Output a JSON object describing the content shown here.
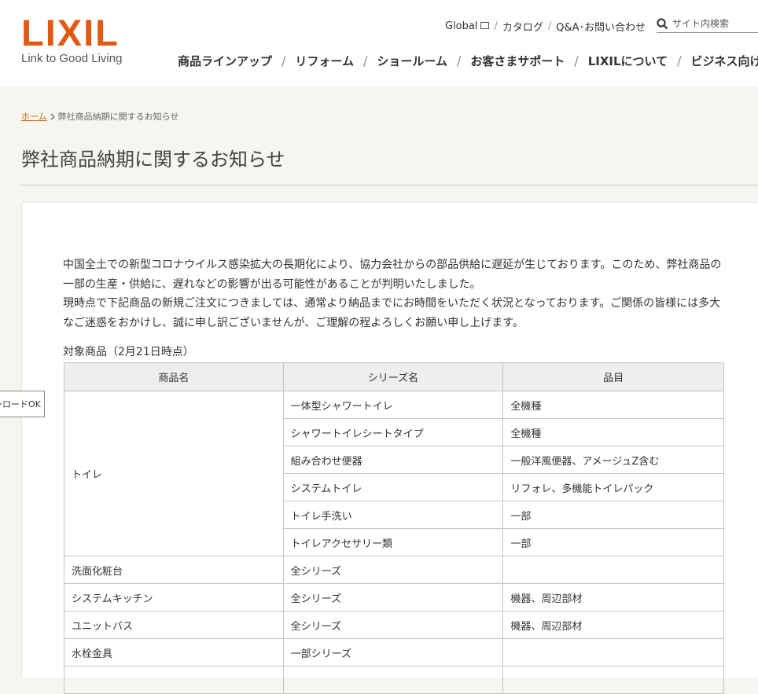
{
  "header": {
    "logo_text": "LIXIL",
    "logo_tagline": "Link to Good Living",
    "utility_links": [
      "Global",
      "カタログ",
      "Q&A･お問い合わせ"
    ],
    "search_placeholder": "サイト内検索",
    "nav_items": [
      "商品ラインアップ",
      "リフォーム",
      "ショールーム",
      "お客さまサポート",
      "LIXILについて",
      "ビジネス向け"
    ],
    "separator": "/"
  },
  "breadcrumb": {
    "home": "ホーム",
    "current": "弊社商品納期に関するお知らせ"
  },
  "page_title": "弊社商品納期に関するお知らせ",
  "lead_paragraphs": [
    "中国全土での新型コロナウイルス感染拡大の長期化により、協力会社からの部品供給に遅延が生じております。このため、弊社商品の一部の生産・供給に、遅れなどの影響が出る可能性があることが判明いたしました。",
    "現時点で下記商品の新規ご注文につきましては、通常より納品までにお時間をいただく状況となっております。ご関係の皆様には多大なご迷惑をおかけし、誠に申し訳ございませんが、ご理解の程よろしくお願い申し上げます。"
  ],
  "table_heading": "対象商品（2月21日時点）",
  "table": {
    "headers": [
      "商品名",
      "シリーズ名",
      "品目"
    ],
    "toilet_group": {
      "product": "トイレ",
      "rows": [
        {
          "series": "一体型シャワートイレ",
          "item": "全機種"
        },
        {
          "series": "シャワートイレシートタイプ",
          "item": "全機種"
        },
        {
          "series": "組み合わせ便器",
          "item": "一般洋風便器、アメージュZ含む"
        },
        {
          "series": "システムトイレ",
          "item": "リフォレ、多機能トイレパック"
        },
        {
          "series": "トイレ手洗い",
          "item": "一部"
        },
        {
          "series": "トイレアクセサリー類",
          "item": "一部"
        }
      ]
    },
    "other_rows": [
      {
        "product": "洗面化粧台",
        "series": "全シリーズ",
        "item": ""
      },
      {
        "product": "システムキッチン",
        "series": "全シリーズ",
        "item": "機器、周辺部材"
      },
      {
        "product": "ユニットバス",
        "series": "全シリーズ",
        "item": "機器、周辺部材"
      },
      {
        "product": "水栓金具",
        "series": "一部シリーズ",
        "item": ""
      }
    ]
  },
  "floating_tab": "ンロードOK",
  "colors": {
    "brand": "#e05a14",
    "link": "#d4650e",
    "page_bg": "#f7f5f0",
    "table_header_bg": "#eeeeee"
  },
  "icons": [
    "external-window-icon",
    "search-icon",
    "chevron-right-icon"
  ]
}
